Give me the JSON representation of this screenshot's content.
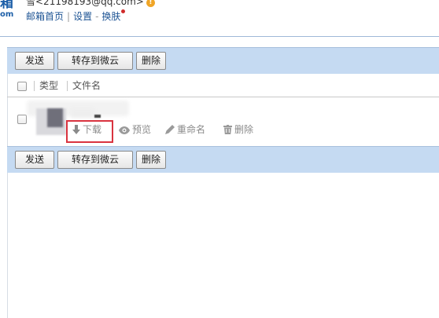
{
  "header": {
    "logo_char": "箱",
    "logo_sub": "om",
    "user": "雪<21198193@qq.com>",
    "warn_glyph": "!",
    "nav": {
      "home": "邮箱首页",
      "sep": "|",
      "settings": "设置",
      "dash": "-",
      "skin": "换肤"
    }
  },
  "toolbar": {
    "send": "发送",
    "save_to_cloud": "转存到微云",
    "delete": "删除"
  },
  "table": {
    "columns": [
      "类型",
      "文件名"
    ]
  },
  "row_actions": {
    "download": "下载",
    "preview": "预览",
    "rename": "重命名",
    "delete": "删除"
  },
  "colors": {
    "toolbar_bg": "#c5daf2",
    "link": "#1e5494",
    "highlight": "#d9333f",
    "action": "#8a8a8a"
  }
}
